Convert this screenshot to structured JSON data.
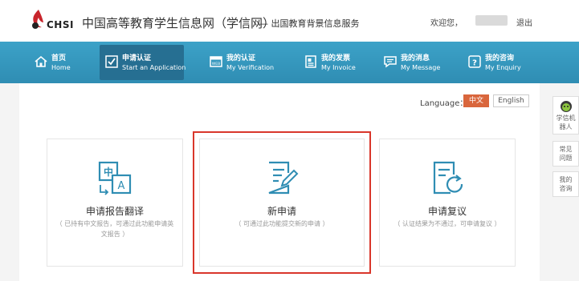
{
  "header": {
    "logo_text": "CHSI",
    "site_title": "中国高等教育学生信息网（学信网）",
    "site_subtitle": "— 出国教育背景信息服务",
    "welcome": "欢迎您，",
    "logout": "退出"
  },
  "nav": {
    "items": [
      {
        "cn": "首页",
        "en": "Home",
        "icon": "home-icon"
      },
      {
        "cn": "申请认证",
        "en": "Start an Application",
        "icon": "checkbox-icon"
      },
      {
        "cn": "我的认证",
        "en": "My Verification",
        "icon": "web-icon"
      },
      {
        "cn": "我的发票",
        "en": "My Invoice",
        "icon": "invoice-icon"
      },
      {
        "cn": "我的消息",
        "en": "My Message",
        "icon": "message-icon"
      },
      {
        "cn": "我的咨询",
        "en": "My Enquiry",
        "icon": "question-icon"
      }
    ],
    "active_index": 1,
    "color": "#3399c0"
  },
  "language": {
    "label": "Language：",
    "options": [
      "中文",
      "English"
    ],
    "selected": "中文",
    "accent": "#d9663c"
  },
  "cards": [
    {
      "title": "申请报告翻译",
      "desc": "（ 已持有中文报告，可通过此功能申请英文报告 ）",
      "icon": "translate-icon"
    },
    {
      "title": "新申请",
      "desc": "（ 可通过此功能提交新的申请 ）",
      "icon": "new-application-icon"
    },
    {
      "title": "申请复议",
      "desc": "（ 认证结果为不通过，可申请复议 ）",
      "icon": "reconsideration-icon"
    }
  ],
  "highlight_color": "#d9362b",
  "side_tools": [
    {
      "label": "学信机器人",
      "icon": "robot-icon"
    },
    {
      "label": "常见问题"
    },
    {
      "label": "我的咨询"
    }
  ]
}
